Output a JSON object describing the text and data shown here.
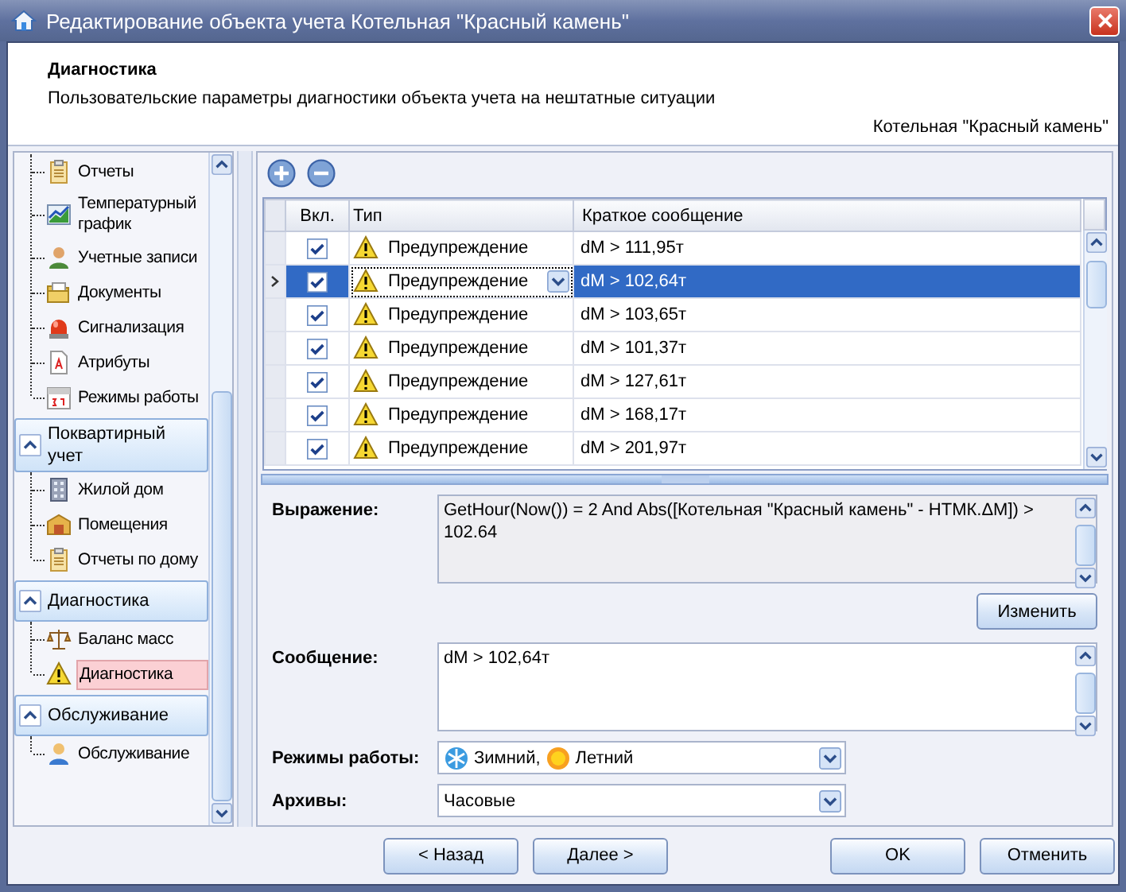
{
  "window": {
    "title": "Редактирование объекта учета Котельная \"Красный камень\""
  },
  "header": {
    "title": "Диагностика",
    "description": "Пользовательские параметры диагностики объекта учета на нештатные ситуации",
    "object": "Котельная \"Красный камень\""
  },
  "sidebar": {
    "items": [
      {
        "label": "Отчеты",
        "kind": "report",
        "selected": false
      },
      {
        "label": "Температурный график",
        "kind": "chart",
        "selected": false
      },
      {
        "label": "Учетные записи",
        "kind": "user",
        "selected": false
      },
      {
        "label": "Документы",
        "kind": "folder",
        "selected": false
      },
      {
        "label": "Сигнализация",
        "kind": "alarm",
        "selected": false
      },
      {
        "label": "Атрибуты",
        "kind": "attribute",
        "selected": false
      },
      {
        "label": "Режимы работы",
        "kind": "calendar",
        "selected": false
      }
    ],
    "groups": [
      {
        "title": "Поквартирный учет",
        "expanded": true,
        "items": [
          {
            "label": "Жилой дом",
            "kind": "building",
            "selected": false
          },
          {
            "label": "Помещения",
            "kind": "rooms",
            "selected": false
          },
          {
            "label": "Отчеты по дому",
            "kind": "report",
            "selected": false
          }
        ]
      },
      {
        "title": "Диагностика",
        "expanded": true,
        "items": [
          {
            "label": "Баланс масс",
            "kind": "scales",
            "selected": false
          },
          {
            "label": "Диагностика",
            "kind": "warning",
            "selected": true
          }
        ]
      },
      {
        "title": "Обслуживание",
        "expanded": true,
        "items": [
          {
            "label": "Обслуживание",
            "kind": "service",
            "selected": false
          }
        ]
      }
    ]
  },
  "grid": {
    "columns": [
      "Вкл.",
      "Тип",
      "Краткое сообщение"
    ],
    "rows": [
      {
        "checked": true,
        "type": "Предупреждение",
        "message": "dM > 111,95т",
        "selected": false
      },
      {
        "checked": true,
        "type": "Предупреждение",
        "message": "dM > 102,64т",
        "selected": true
      },
      {
        "checked": true,
        "type": "Предупреждение",
        "message": "dM > 103,65т",
        "selected": false
      },
      {
        "checked": true,
        "type": "Предупреждение",
        "message": "dM > 101,37т",
        "selected": false
      },
      {
        "checked": true,
        "type": "Предупреждение",
        "message": "dM > 127,61т",
        "selected": false
      },
      {
        "checked": true,
        "type": "Предупреждение",
        "message": "dM > 168,17т",
        "selected": false
      },
      {
        "checked": true,
        "type": "Предупреждение",
        "message": "dM > 201,97т",
        "selected": false
      }
    ]
  },
  "form": {
    "expression": {
      "label": "Выражение:",
      "value": "GetHour(Now()) = 2 And Abs([Котельная \"Красный камень\" - НТМК.ΔМ]) > 102.64",
      "read_only": true
    },
    "edit_button": "Изменить",
    "message": {
      "label": "Сообщение:",
      "value": "dM > 102,64т"
    },
    "modes": {
      "label": "Режимы работы:",
      "values": [
        {
          "kind": "winter",
          "label": "Зимний,"
        },
        {
          "kind": "summer",
          "label": "Летний"
        }
      ]
    },
    "archives": {
      "label": "Архивы:",
      "value": "Часовые"
    }
  },
  "nav_buttons": [
    "< Назад",
    "Далее >"
  ],
  "dialog_buttons": [
    "OK",
    "Отменить"
  ]
}
